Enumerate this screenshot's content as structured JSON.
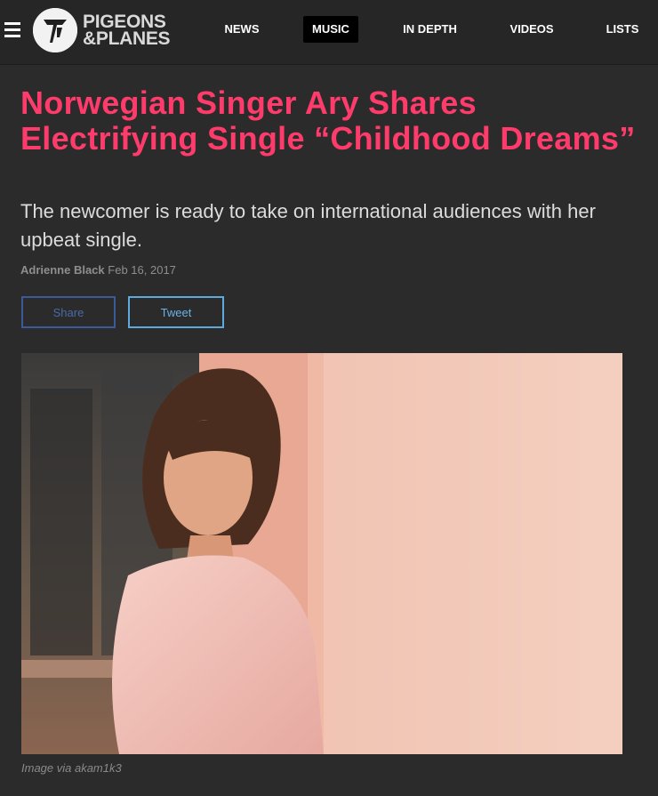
{
  "nav": {
    "logo": {
      "line1": "PIGEONS",
      "line2": "&PLANES"
    },
    "items": [
      {
        "label": "NEWS",
        "active": false
      },
      {
        "label": "MUSIC",
        "active": true
      },
      {
        "label": "IN DEPTH",
        "active": false
      },
      {
        "label": "VIDEOS",
        "active": false
      },
      {
        "label": "LISTS",
        "active": false
      }
    ]
  },
  "article": {
    "title": "Norwegian Singer Ary Shares Electrifying Single “Childhood Dreams”",
    "dek": "The newcomer is ready to take on international audiences with her upbeat single.",
    "author": "Adrienne Black",
    "date": "Feb 16, 2017",
    "share": {
      "facebook_label": "Share",
      "twitter_label": "Tweet"
    },
    "image_caption": "Image via akam1k3"
  },
  "colors": {
    "headline": "#ff3b6b",
    "background": "#2b2b2b",
    "facebook": "#3a5a99",
    "twitter": "#5ea9dd"
  },
  "icons": {
    "menu": "hamburger-icon",
    "logo": "pigeons-planes-logo"
  }
}
